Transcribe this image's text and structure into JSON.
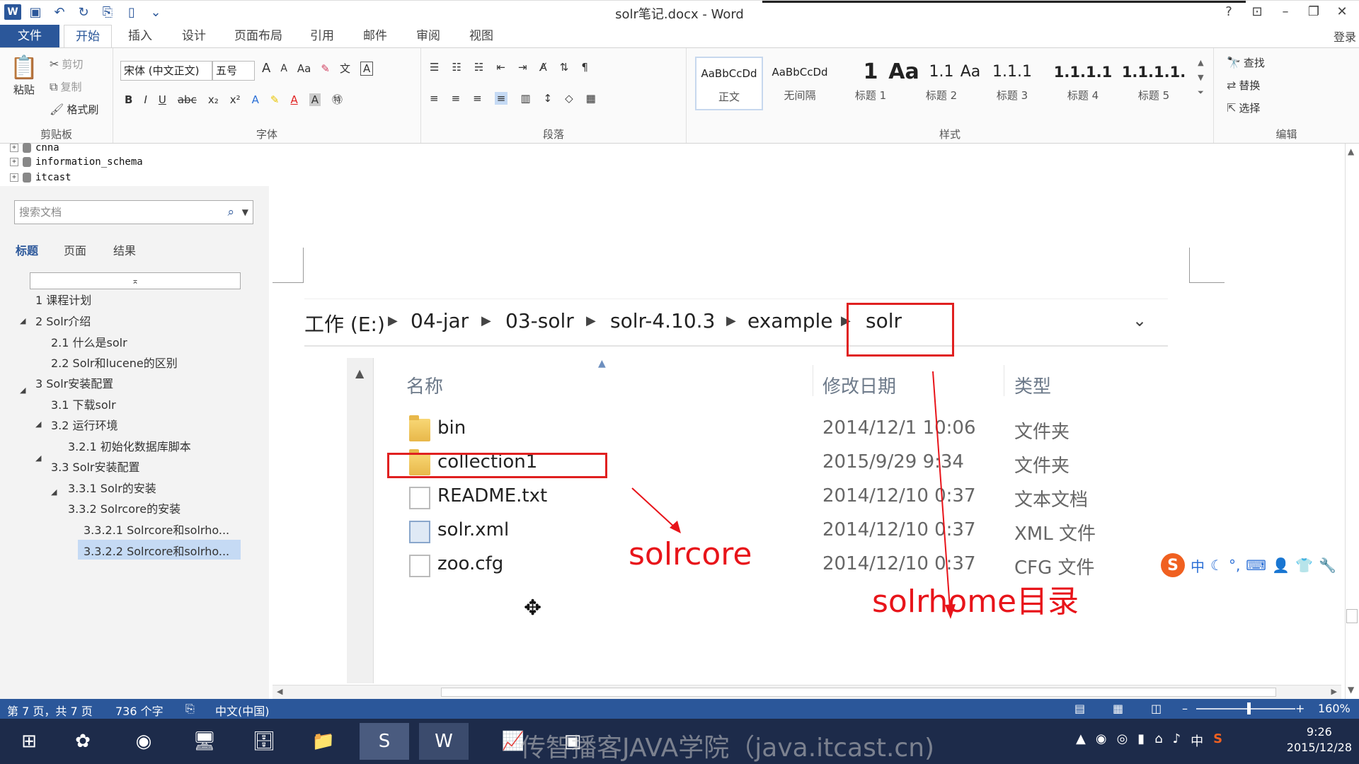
{
  "window": {
    "title": "solr笔记.docx - Word",
    "login": "登录"
  },
  "ribbon_tabs": [
    "文件",
    "开始",
    "插入",
    "设计",
    "页面布局",
    "引用",
    "邮件",
    "审阅",
    "视图"
  ],
  "clipboard": {
    "paste": "粘贴",
    "cut": "剪切",
    "copy": "复制",
    "format_painter": "格式刷",
    "group": "剪贴板"
  },
  "font": {
    "name": "宋体 (中文正文)",
    "size": "五号",
    "group": "字体",
    "bold": "B",
    "italic": "I",
    "underline": "U",
    "strike": "abc",
    "sub": "x₂",
    "sup": "x²",
    "case": "Aa",
    "grow": "A",
    "shrink": "A"
  },
  "paragraph": {
    "group": "段落"
  },
  "styles": {
    "group": "样式",
    "items": [
      {
        "preview": "AaBbCcDd",
        "name": "正文"
      },
      {
        "preview": "AaBbCcDd",
        "name": "无间隔"
      },
      {
        "preview": "1",
        "name": "标题 1"
      },
      {
        "preview": "Aa",
        "name": "标题 2"
      },
      {
        "preview": "1.1",
        "name": "标题 3"
      },
      {
        "preview": "Aa",
        "name": "标题 4"
      },
      {
        "preview": "1.1.1",
        "name": "标题 5"
      },
      {
        "preview": "1.1.1.1",
        "name": ""
      },
      {
        "preview": "1.1.1.1.",
        "name": ""
      }
    ]
  },
  "editing": {
    "find": "查找",
    "replace": "替换",
    "select": "选择",
    "group": "编辑"
  },
  "tree_rows": [
    "cnna",
    "information_schema",
    "itcast"
  ],
  "nav": {
    "search_placeholder": "搜索文档",
    "tabs": [
      "标题",
      "页面",
      "结果"
    ],
    "items": [
      {
        "text": "1 课程计划",
        "level": 0
      },
      {
        "text": "2 Solr介绍",
        "level": 0
      },
      {
        "text": "2.1 什么是solr",
        "level": 1
      },
      {
        "text": "2.2 Solr和lucene的区别",
        "level": 1
      },
      {
        "text": "3 Solr安装配置",
        "level": 0
      },
      {
        "text": "3.1 下载solr",
        "level": 1
      },
      {
        "text": "3.2 运行环境",
        "level": 1
      },
      {
        "text": "3.2.1 初始化数据库脚本",
        "level": 2
      },
      {
        "text": "3.3 Solr安装配置",
        "level": 1
      },
      {
        "text": "3.3.1 Solr的安装",
        "level": 2
      },
      {
        "text": "3.3.2 Solrcore的安装",
        "level": 2
      },
      {
        "text": "3.3.2.1 Solrcore和solrho...",
        "level": 3
      },
      {
        "text": "3.3.2.2 Solrcore和solrho...",
        "level": 3
      }
    ]
  },
  "explorer": {
    "breadcrumb": [
      "工作 (E:)",
      "04-jar",
      "03-solr",
      "solr-4.10.3",
      "example",
      "solr"
    ],
    "columns": [
      "名称",
      "修改日期",
      "类型"
    ],
    "files": [
      {
        "name": "bin",
        "date": "2014/12/1 10:06",
        "type": "文件夹",
        "icon": "folder-icon"
      },
      {
        "name": "collection1",
        "date": "2015/9/29 9:34",
        "type": "文件夹",
        "icon": "folder-icon"
      },
      {
        "name": "README.txt",
        "date": "2014/12/10 0:37",
        "type": "文本文档",
        "icon": "text-file-icon"
      },
      {
        "name": "solr.xml",
        "date": "2014/12/10 0:37",
        "type": "XML 文件",
        "icon": "xml-file-icon"
      },
      {
        "name": "zoo.cfg",
        "date": "2014/12/10 0:37",
        "type": "CFG 文件",
        "icon": "cfg-file-icon"
      }
    ]
  },
  "annotations": {
    "solrcore": "solrcore",
    "solrhome": "solrhome目录"
  },
  "ime": {
    "lang": "中"
  },
  "status": {
    "page": "第 7 页，共 7 页",
    "words": "736 个字",
    "lang": "中文(中国)",
    "zoom": "160%"
  },
  "taskbar": {
    "watermark": "传智播客JAVA学院（java.itcast.cn)",
    "ime_lang": "中",
    "time": "9:26",
    "date": "2015/12/28"
  },
  "colors": {
    "accent": "#2b579a",
    "annotation": "#e8141a"
  }
}
